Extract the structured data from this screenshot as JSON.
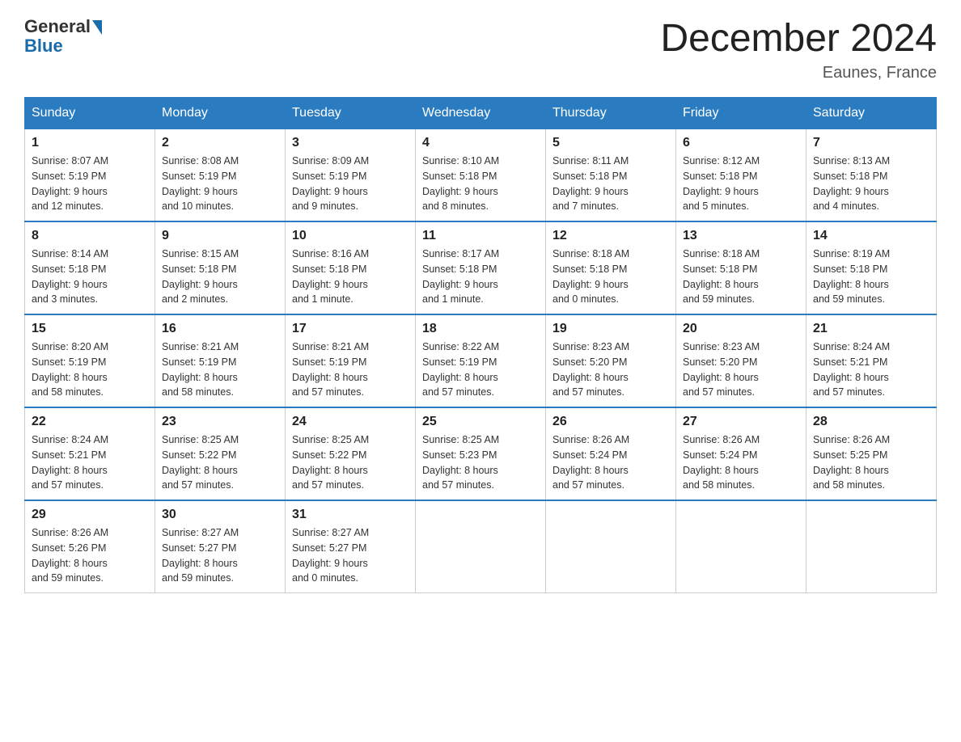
{
  "header": {
    "title": "December 2024",
    "location": "Eaunes, France",
    "logo_general": "General",
    "logo_blue": "Blue"
  },
  "weekdays": [
    "Sunday",
    "Monday",
    "Tuesday",
    "Wednesday",
    "Thursday",
    "Friday",
    "Saturday"
  ],
  "weeks": [
    [
      {
        "day": "1",
        "sunrise": "8:07 AM",
        "sunset": "5:19 PM",
        "daylight": "9 hours and 12 minutes."
      },
      {
        "day": "2",
        "sunrise": "8:08 AM",
        "sunset": "5:19 PM",
        "daylight": "9 hours and 10 minutes."
      },
      {
        "day": "3",
        "sunrise": "8:09 AM",
        "sunset": "5:19 PM",
        "daylight": "9 hours and 9 minutes."
      },
      {
        "day": "4",
        "sunrise": "8:10 AM",
        "sunset": "5:18 PM",
        "daylight": "9 hours and 8 minutes."
      },
      {
        "day": "5",
        "sunrise": "8:11 AM",
        "sunset": "5:18 PM",
        "daylight": "9 hours and 7 minutes."
      },
      {
        "day": "6",
        "sunrise": "8:12 AM",
        "sunset": "5:18 PM",
        "daylight": "9 hours and 5 minutes."
      },
      {
        "day": "7",
        "sunrise": "8:13 AM",
        "sunset": "5:18 PM",
        "daylight": "9 hours and 4 minutes."
      }
    ],
    [
      {
        "day": "8",
        "sunrise": "8:14 AM",
        "sunset": "5:18 PM",
        "daylight": "9 hours and 3 minutes."
      },
      {
        "day": "9",
        "sunrise": "8:15 AM",
        "sunset": "5:18 PM",
        "daylight": "9 hours and 2 minutes."
      },
      {
        "day": "10",
        "sunrise": "8:16 AM",
        "sunset": "5:18 PM",
        "daylight": "9 hours and 1 minute."
      },
      {
        "day": "11",
        "sunrise": "8:17 AM",
        "sunset": "5:18 PM",
        "daylight": "9 hours and 1 minute."
      },
      {
        "day": "12",
        "sunrise": "8:18 AM",
        "sunset": "5:18 PM",
        "daylight": "9 hours and 0 minutes."
      },
      {
        "day": "13",
        "sunrise": "8:18 AM",
        "sunset": "5:18 PM",
        "daylight": "8 hours and 59 minutes."
      },
      {
        "day": "14",
        "sunrise": "8:19 AM",
        "sunset": "5:18 PM",
        "daylight": "8 hours and 59 minutes."
      }
    ],
    [
      {
        "day": "15",
        "sunrise": "8:20 AM",
        "sunset": "5:19 PM",
        "daylight": "8 hours and 58 minutes."
      },
      {
        "day": "16",
        "sunrise": "8:21 AM",
        "sunset": "5:19 PM",
        "daylight": "8 hours and 58 minutes."
      },
      {
        "day": "17",
        "sunrise": "8:21 AM",
        "sunset": "5:19 PM",
        "daylight": "8 hours and 57 minutes."
      },
      {
        "day": "18",
        "sunrise": "8:22 AM",
        "sunset": "5:19 PM",
        "daylight": "8 hours and 57 minutes."
      },
      {
        "day": "19",
        "sunrise": "8:23 AM",
        "sunset": "5:20 PM",
        "daylight": "8 hours and 57 minutes."
      },
      {
        "day": "20",
        "sunrise": "8:23 AM",
        "sunset": "5:20 PM",
        "daylight": "8 hours and 57 minutes."
      },
      {
        "day": "21",
        "sunrise": "8:24 AM",
        "sunset": "5:21 PM",
        "daylight": "8 hours and 57 minutes."
      }
    ],
    [
      {
        "day": "22",
        "sunrise": "8:24 AM",
        "sunset": "5:21 PM",
        "daylight": "8 hours and 57 minutes."
      },
      {
        "day": "23",
        "sunrise": "8:25 AM",
        "sunset": "5:22 PM",
        "daylight": "8 hours and 57 minutes."
      },
      {
        "day": "24",
        "sunrise": "8:25 AM",
        "sunset": "5:22 PM",
        "daylight": "8 hours and 57 minutes."
      },
      {
        "day": "25",
        "sunrise": "8:25 AM",
        "sunset": "5:23 PM",
        "daylight": "8 hours and 57 minutes."
      },
      {
        "day": "26",
        "sunrise": "8:26 AM",
        "sunset": "5:24 PM",
        "daylight": "8 hours and 57 minutes."
      },
      {
        "day": "27",
        "sunrise": "8:26 AM",
        "sunset": "5:24 PM",
        "daylight": "8 hours and 58 minutes."
      },
      {
        "day": "28",
        "sunrise": "8:26 AM",
        "sunset": "5:25 PM",
        "daylight": "8 hours and 58 minutes."
      }
    ],
    [
      {
        "day": "29",
        "sunrise": "8:26 AM",
        "sunset": "5:26 PM",
        "daylight": "8 hours and 59 minutes."
      },
      {
        "day": "30",
        "sunrise": "8:27 AM",
        "sunset": "5:27 PM",
        "daylight": "8 hours and 59 minutes."
      },
      {
        "day": "31",
        "sunrise": "8:27 AM",
        "sunset": "5:27 PM",
        "daylight": "9 hours and 0 minutes."
      },
      null,
      null,
      null,
      null
    ]
  ]
}
